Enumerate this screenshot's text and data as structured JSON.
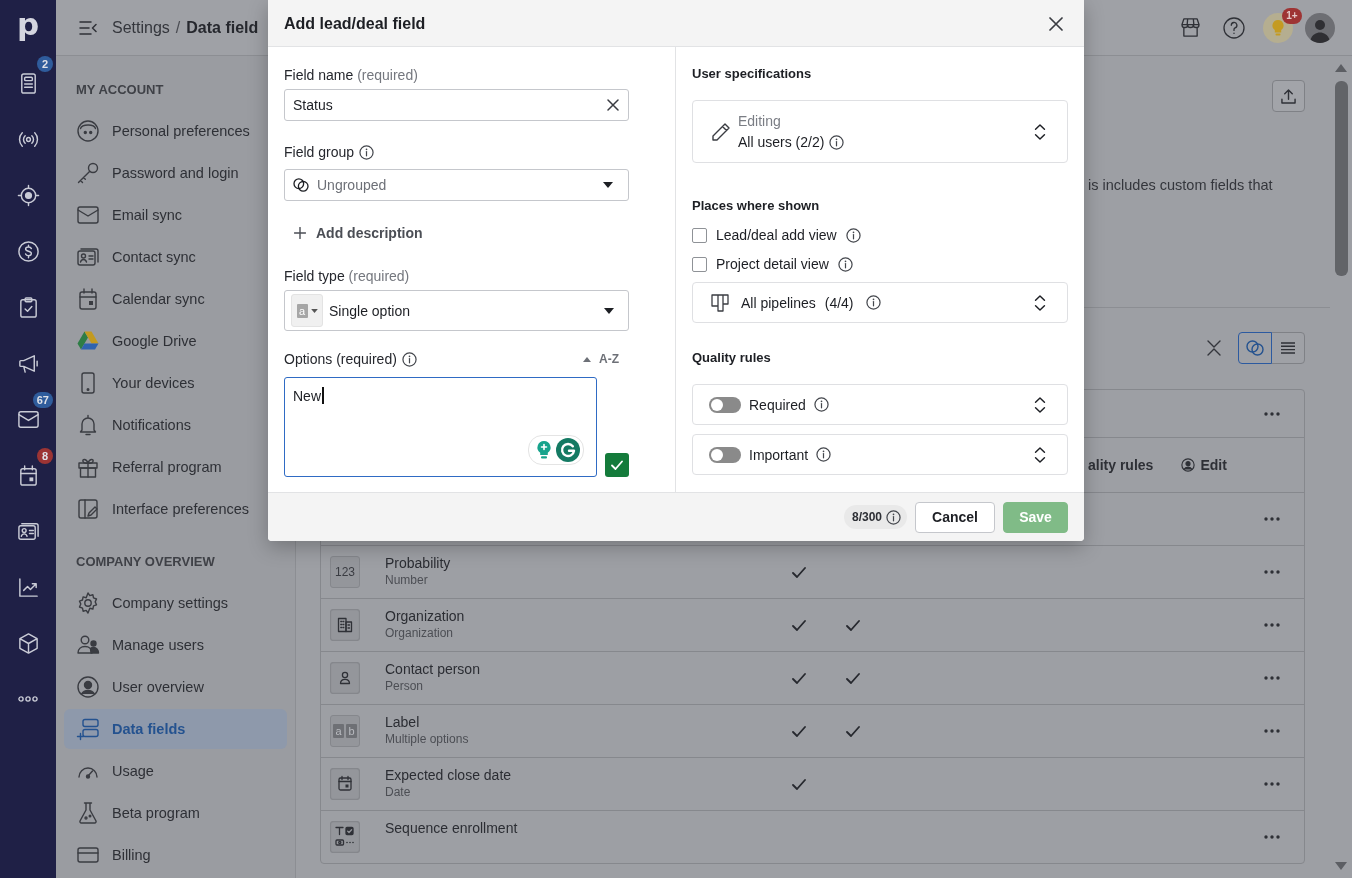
{
  "rail": {
    "logo": "p",
    "items": [
      {
        "selected": false,
        "badge": "2",
        "color": "#2f5c9c"
      },
      {
        "selected": false
      },
      {
        "selected": false
      },
      {
        "selected": false
      },
      {
        "selected": false
      },
      {
        "selected": false
      },
      {
        "selected": false,
        "badge": "67",
        "color": "#2f5c9c"
      },
      {
        "selected": false,
        "badge": "8",
        "color": "#9c3434"
      },
      {
        "selected": false
      },
      {
        "selected": false
      },
      {
        "selected": false
      },
      {
        "selected": false
      }
    ]
  },
  "header": {
    "breadcrumb": {
      "parent": "Settings",
      "separator": "/",
      "current": "Data field"
    },
    "tips_badge": "1+"
  },
  "sidebar": {
    "sections": [
      {
        "title": "MY ACCOUNT",
        "items": [
          {
            "label": "Personal preferences",
            "selected": false
          },
          {
            "label": "Password and login",
            "selected": false
          },
          {
            "label": "Email sync",
            "selected": false
          },
          {
            "label": "Contact sync",
            "selected": false
          },
          {
            "label": "Calendar sync",
            "selected": false
          },
          {
            "label": "Google Drive",
            "selected": false
          },
          {
            "label": "Your devices",
            "selected": false
          },
          {
            "label": "Notifications",
            "selected": false
          },
          {
            "label": "Referral program",
            "selected": false
          },
          {
            "label": "Interface preferences",
            "selected": false
          }
        ]
      },
      {
        "title": "COMPANY OVERVIEW",
        "items": [
          {
            "label": "Company settings",
            "selected": false
          },
          {
            "label": "Manage users",
            "selected": false
          },
          {
            "label": "User overview",
            "selected": false
          },
          {
            "label": "Data fields",
            "selected": true
          },
          {
            "label": "Usage",
            "selected": false
          },
          {
            "label": "Beta program",
            "selected": false
          },
          {
            "label": "Billing",
            "selected": false
          }
        ]
      }
    ]
  },
  "main": {
    "description": "is includes custom fields that",
    "view_toggle": [
      {
        "selected": true
      },
      {
        "selected": false
      }
    ],
    "table": {
      "rows": [
        {
          "kind": "group"
        },
        {
          "kind": "header",
          "columns": [
            "ality rules",
            "Edit"
          ]
        },
        {
          "kind": "covered"
        },
        {
          "kind": "field",
          "name": "Probability",
          "type": "Number",
          "icon_text": "123",
          "checks": [
            true,
            false
          ]
        },
        {
          "kind": "field",
          "name": "Organization",
          "type": "Organization",
          "checks": [
            true,
            true
          ]
        },
        {
          "kind": "field",
          "name": "Contact person",
          "type": "Person",
          "checks": [
            true,
            true
          ]
        },
        {
          "kind": "field",
          "name": "Label",
          "type": "Multiple options",
          "icon_letters": [
            "a",
            "b"
          ],
          "checks": [
            true,
            true
          ]
        },
        {
          "kind": "field",
          "name": "Expected close date",
          "type": "Date",
          "checks": [
            true,
            false
          ]
        },
        {
          "kind": "field",
          "name": "Sequence enrollment",
          "checks": [
            false,
            false
          ]
        }
      ]
    }
  },
  "modal": {
    "title": "Add lead/deal field",
    "field_name": {
      "label": "Field name",
      "note": "(required)",
      "value": "Status"
    },
    "field_group": {
      "label": "Field group",
      "value": "Ungrouped"
    },
    "add_description": "Add description",
    "field_type": {
      "label": "Field type",
      "note": "(required)",
      "icon_letter": "a",
      "value": "Single option"
    },
    "options": {
      "label": "Options (required)",
      "sort": "A-Z",
      "value": "New"
    },
    "user_specifications": {
      "title": "User specifications",
      "caption": "Editing",
      "value": "All users (2/2)"
    },
    "places": {
      "title": "Places where shown",
      "views": [
        {
          "label": "Lead/deal add view",
          "checked": false
        },
        {
          "label": "Project detail view",
          "checked": false
        }
      ],
      "pipelines": {
        "label": "All pipelines",
        "count": "(4/4)"
      }
    },
    "quality_rules": {
      "title": "Quality rules",
      "rules": [
        {
          "label": "Required",
          "on": false
        },
        {
          "label": "Important",
          "on": false
        }
      ]
    },
    "footer": {
      "counter": "8/300",
      "buttons": [
        {
          "label": "Cancel",
          "kind": "secondary"
        },
        {
          "label": "Save",
          "kind": "primary",
          "disabled": true
        }
      ]
    }
  }
}
